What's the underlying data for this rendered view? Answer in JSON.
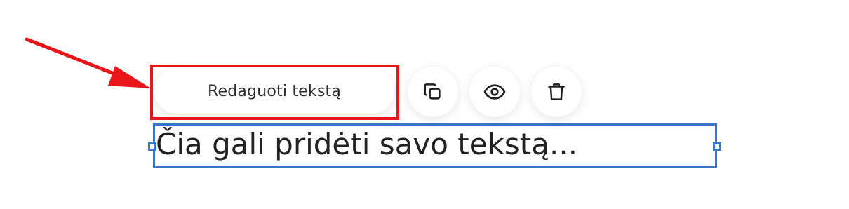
{
  "toolbar": {
    "edit_text_label": "Redaguoti tekstą",
    "duplicate_icon": "copy-icon",
    "preview_icon": "eye-icon",
    "delete_icon": "trash-icon"
  },
  "editor": {
    "text_block_content": "Čia gali pridėti savo tekstą..."
  },
  "colors": {
    "highlight": "#e8161b",
    "selection": "#3a74c6",
    "arrow": "#e8161b"
  }
}
